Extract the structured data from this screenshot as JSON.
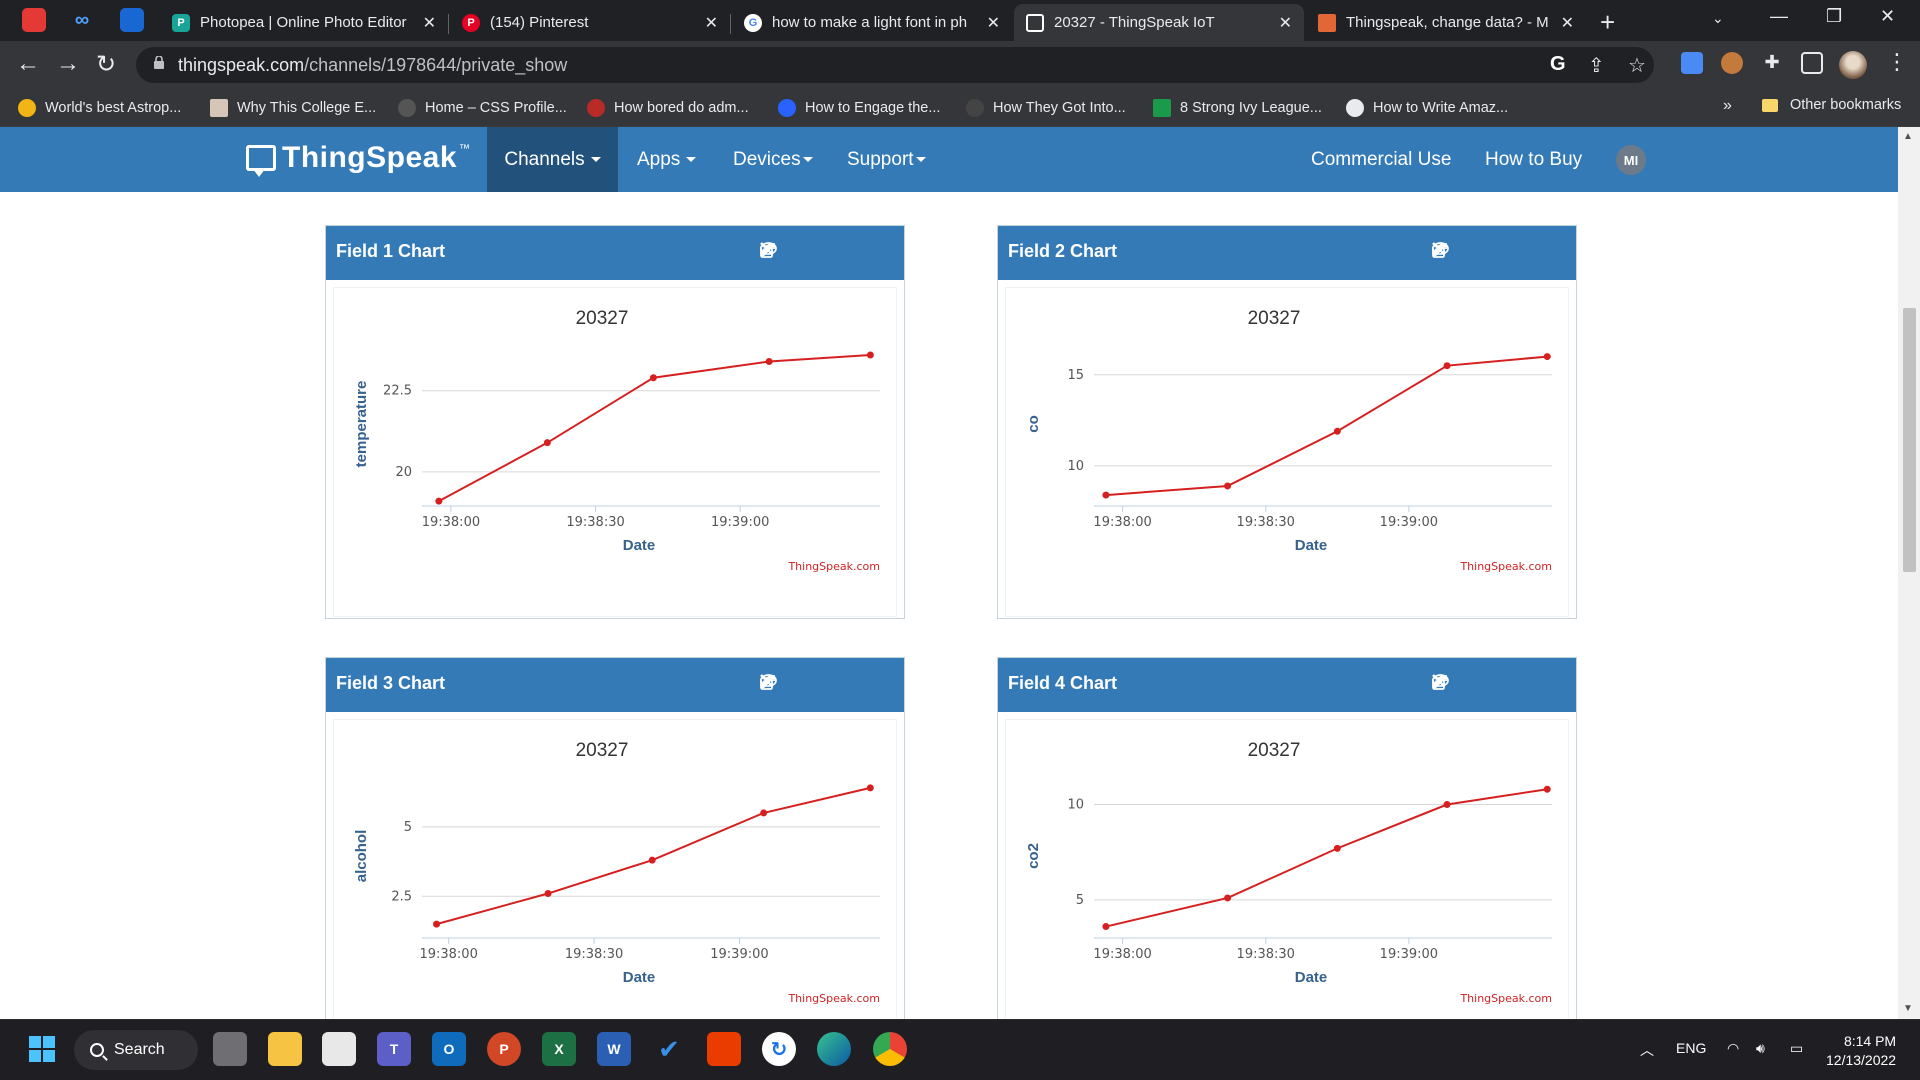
{
  "browser": {
    "tabs": [
      {
        "title": "Photopea | Online Photo Editor",
        "favicon": "photopea-icon",
        "color": "#18a497",
        "active": false
      },
      {
        "title": "(154) Pinterest",
        "favicon": "pinterest-icon",
        "color": "#e60023",
        "active": false
      },
      {
        "title": "how to make a light font in ph",
        "favicon": "google-icon",
        "color": "#ffffff",
        "active": false
      },
      {
        "title": "20327 - ThingSpeak IoT",
        "favicon": "thingspeak-icon",
        "color": "#ffffff",
        "active": true
      },
      {
        "title": "Thingspeak, change data? - M",
        "favicon": "mathworks-icon",
        "color": "#e16737",
        "active": false
      }
    ],
    "url_host": "thingspeak.com",
    "url_path": "/channels/1978644/private_show",
    "bookmarks": [
      "World's best Astrop...",
      "Why This College E...",
      "Home – CSS Profile...",
      "How bored do adm...",
      "How to Engage the...",
      "How They Got Into...",
      "8 Strong Ivy League...",
      "How to Write Amaz..."
    ],
    "bookmarks_more": "»",
    "other_bookmarks": "Other bookmarks"
  },
  "site": {
    "logo": "ThingSpeak",
    "logo_tm": "™",
    "nav": {
      "channels": "Channels",
      "apps": "Apps",
      "devices": "Devices",
      "support": "Support",
      "commercial": "Commercial Use",
      "buy": "How to Buy"
    },
    "avatar": "MI",
    "accent": "#337ab7"
  },
  "charts": [
    {
      "header": "Field 1 Chart",
      "title": "20327",
      "xlabel": "Date",
      "ylabel": "temperature",
      "credit": "ThingSpeak.com"
    },
    {
      "header": "Field 2 Chart",
      "title": "20327",
      "xlabel": "Date",
      "ylabel": "co",
      "credit": "ThingSpeak.com"
    },
    {
      "header": "Field 3 Chart",
      "title": "20327",
      "xlabel": "Date",
      "ylabel": "alcohol",
      "credit": "ThingSpeak.com"
    },
    {
      "header": "Field 4 Chart",
      "title": "20327",
      "xlabel": "Date",
      "ylabel": "co2",
      "credit": "ThingSpeak.com"
    }
  ],
  "chart_data": [
    {
      "type": "line",
      "title": "20327",
      "xlabel": "Date",
      "ylabel": "temperature",
      "x_ticks": [
        "19:38:00",
        "19:38:30",
        "19:39:00"
      ],
      "x_seconds": [
        0,
        30,
        60
      ],
      "y_ticks": [
        20,
        22.5
      ],
      "x": [
        -2.5,
        20,
        42,
        66,
        87
      ],
      "y": [
        19.1,
        20.9,
        22.9,
        23.4,
        23.6
      ],
      "color": "#d62020",
      "grid": true
    },
    {
      "type": "line",
      "title": "20327",
      "xlabel": "Date",
      "ylabel": "co",
      "x_ticks": [
        "19:38:00",
        "19:38:30",
        "19:39:00"
      ],
      "x_seconds": [
        0,
        30,
        60
      ],
      "y_ticks": [
        10,
        15
      ],
      "x": [
        -3.5,
        22,
        45,
        68,
        89
      ],
      "y": [
        8.4,
        8.9,
        11.9,
        15.5,
        16.0
      ],
      "color": "#d62020",
      "grid": true
    },
    {
      "type": "line",
      "title": "20327",
      "xlabel": "Date",
      "ylabel": "alcohol",
      "x_ticks": [
        "19:38:00",
        "19:38:30",
        "19:39:00"
      ],
      "x_seconds": [
        0,
        30,
        60
      ],
      "y_ticks": [
        2.5,
        5
      ],
      "x": [
        -2.5,
        20.5,
        42,
        65,
        87
      ],
      "y": [
        1.5,
        2.6,
        3.8,
        5.5,
        6.4
      ],
      "color": "#d62020",
      "grid": true
    },
    {
      "type": "line",
      "title": "20327",
      "xlabel": "Date",
      "ylabel": "co2",
      "x_ticks": [
        "19:38:00",
        "19:38:30",
        "19:39:00"
      ],
      "x_seconds": [
        0,
        30,
        60
      ],
      "y_ticks": [
        5,
        10
      ],
      "x": [
        -3.5,
        22,
        45,
        68,
        89
      ],
      "y": [
        3.6,
        5.1,
        7.7,
        10.0,
        10.8
      ],
      "color": "#d62020",
      "grid": true
    }
  ],
  "taskbar": {
    "search": "Search",
    "lang": "ENG",
    "time": "8:14 PM",
    "date": "12/13/2022"
  }
}
